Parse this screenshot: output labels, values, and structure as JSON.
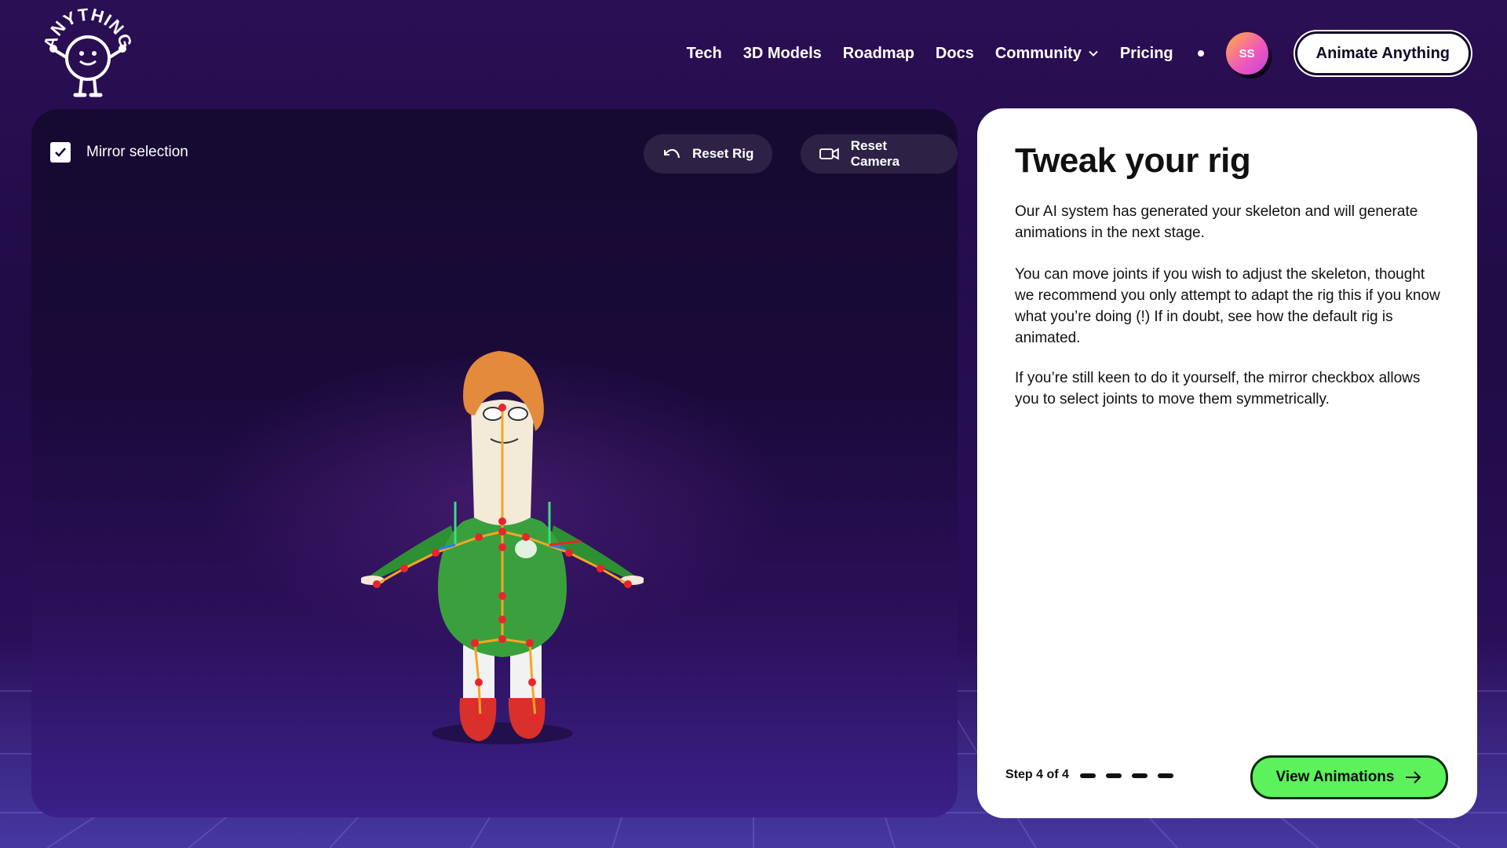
{
  "brand": {
    "logo_text": "ANYTHING"
  },
  "nav": {
    "links": [
      "Tech",
      "3D Models",
      "Roadmap",
      "Docs",
      "Community",
      "Pricing"
    ],
    "avatar_initials": "SS",
    "cta_label": "Animate Anything"
  },
  "viewport": {
    "mirror_label": "Mirror selection",
    "mirror_checked": true,
    "reset_rig_label": "Reset Rig",
    "reset_camera_label": "Reset Camera"
  },
  "panel": {
    "title": "Tweak your rig",
    "paragraphs": [
      "Our AI system has generated your skeleton and will generate animations in the next stage.",
      "You can move joints if you wish to adjust the skeleton, thought we recommend you only attempt to adapt the rig this if you know what you’re doing (!) If in doubt, see how the default rig is animated.",
      "If you’re still keen to do it yourself, the mirror checkbox allows you to select joints to move them symmetrically."
    ],
    "step_label": "Step 4 of 4",
    "step_current": 4,
    "step_total": 4,
    "next_button_label": "View Animations"
  },
  "colors": {
    "accent_green": "#5cf25c",
    "joint_red": "#e8262a",
    "bone_orange": "#f5a623",
    "background_purple": "#2b0f55"
  }
}
